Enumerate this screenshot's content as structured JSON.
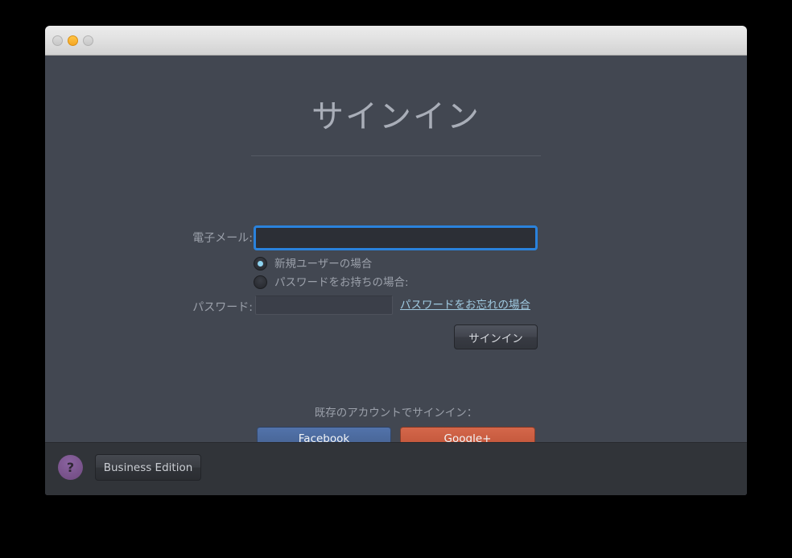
{
  "window": {
    "traffic_lights": [
      {
        "name": "close",
        "color": "#d0d0d0",
        "label": ""
      },
      {
        "name": "minimize",
        "color": "#f5a623",
        "label": ""
      },
      {
        "name": "zoom",
        "color": "#d0d0d0",
        "label": ""
      }
    ],
    "background": "#424751",
    "footer_background": "#313439"
  },
  "main": {
    "title": "サインイン",
    "email": {
      "label": "電子メール:",
      "value": "",
      "placeholder": "",
      "focused": true,
      "focus_color": "#2a82dc"
    },
    "radios": [
      {
        "label": "新規ユーザーの場合",
        "checked": true
      },
      {
        "label": "パスワードをお持ちの場合:",
        "checked": false
      }
    ],
    "password": {
      "label": "パスワード:",
      "value": "",
      "placeholder": "",
      "disabled": true
    },
    "forgot_link": "パスワードをお忘れの場合",
    "signin_button": "サインイン",
    "social": {
      "caption": "既存のアカウントでサインイン：",
      "facebook_label": "Facebook",
      "facebook_color": "#4c6a9c",
      "googleplus_label": "Google+",
      "googleplus_color": "#c95a3d"
    }
  },
  "footer": {
    "help_label": "?",
    "help_color": "#7b5590",
    "business_edition_label": "Business Edition"
  }
}
